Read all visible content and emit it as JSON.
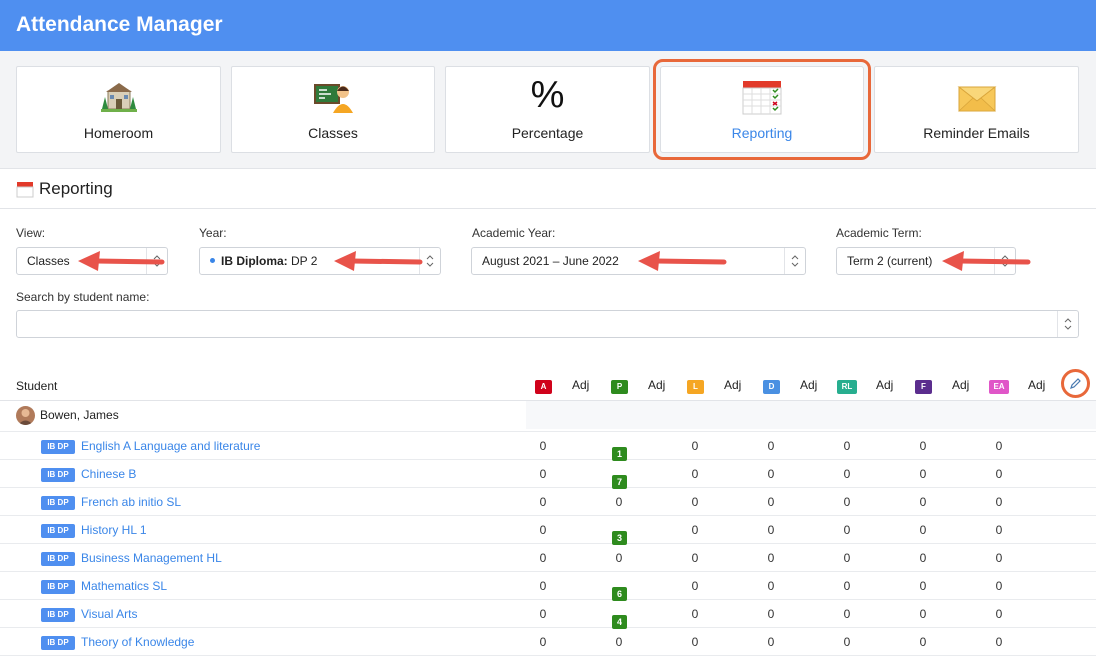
{
  "app": {
    "title": "Attendance Manager"
  },
  "tiles": [
    {
      "label": "Homeroom",
      "icon": "school-building-icon",
      "active": false
    },
    {
      "label": "Classes",
      "icon": "teacher-board-icon",
      "active": false
    },
    {
      "label": "Percentage",
      "icon": "percent-icon",
      "symbol": "%",
      "active": false
    },
    {
      "label": "Reporting",
      "icon": "report-grid-icon",
      "active": true
    },
    {
      "label": "Reminder Emails",
      "icon": "envelope-icon",
      "active": false
    }
  ],
  "section": {
    "title": "Reporting",
    "icon": "calendar-icon"
  },
  "filters": {
    "view": {
      "label": "View:",
      "value": "Classes"
    },
    "year": {
      "label": "Year:",
      "value_bold": "IB Diploma:",
      "value_rest": " DP 2"
    },
    "academic_year": {
      "label": "Academic Year:",
      "value": "August 2021 – June 2022"
    },
    "academic_term": {
      "label": "Academic Term:",
      "value": "Term 2 (current)"
    },
    "search": {
      "label": "Search by student name:",
      "value": ""
    }
  },
  "table": {
    "student_header": "Student",
    "adj_label": "Adj",
    "codes": [
      {
        "code": "A",
        "color": "#d0021b"
      },
      {
        "code": "P",
        "color": "#2e8b1e"
      },
      {
        "code": "L",
        "color": "#f5a623"
      },
      {
        "code": "D",
        "color": "#4a90e2"
      },
      {
        "code": "RL",
        "color": "#27ae8f"
      },
      {
        "code": "F",
        "color": "#5b2d8e"
      },
      {
        "code": "EA",
        "color": "#e056c8"
      }
    ],
    "student": {
      "name": "Bowen, James"
    },
    "tag": "IB DP",
    "rows": [
      {
        "course": "English A Language and literature",
        "values": [
          "0",
          "1",
          "0",
          "0",
          "0",
          "0",
          "0"
        ],
        "p_badge": true
      },
      {
        "course": "Chinese B",
        "values": [
          "0",
          "7",
          "0",
          "0",
          "0",
          "0",
          "0"
        ],
        "p_badge": true
      },
      {
        "course": "French ab initio SL",
        "values": [
          "0",
          "0",
          "0",
          "0",
          "0",
          "0",
          "0"
        ],
        "p_badge": false
      },
      {
        "course": "History HL 1",
        "values": [
          "0",
          "3",
          "0",
          "0",
          "0",
          "0",
          "0"
        ],
        "p_badge": true
      },
      {
        "course": "Business Management HL",
        "values": [
          "0",
          "0",
          "0",
          "0",
          "0",
          "0",
          "0"
        ],
        "p_badge": false
      },
      {
        "course": "Mathematics SL",
        "values": [
          "0",
          "6",
          "0",
          "0",
          "0",
          "0",
          "0"
        ],
        "p_badge": true
      },
      {
        "course": "Visual Arts",
        "values": [
          "0",
          "4",
          "0",
          "0",
          "0",
          "0",
          "0"
        ],
        "p_badge": true
      },
      {
        "course": "Theory of Knowledge",
        "values": [
          "0",
          "0",
          "0",
          "0",
          "0",
          "0",
          "0"
        ],
        "p_badge": false
      }
    ]
  },
  "colors": {
    "header": "#4f8ff0",
    "accent": "#3a86e8",
    "highlight": "#e8683a"
  }
}
